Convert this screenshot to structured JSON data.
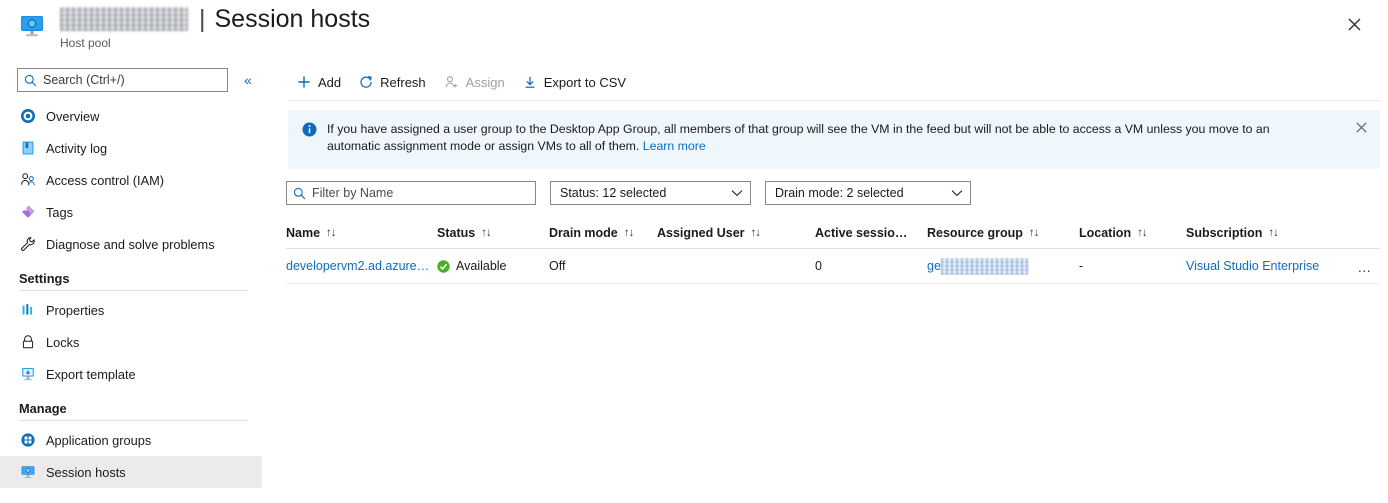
{
  "header": {
    "resource_icon": "virtual-desktop-host-pool-icon",
    "title_redacted": true,
    "separator": "|",
    "title": "Session hosts",
    "subtitle": "Host pool",
    "close_label": "✕"
  },
  "sidebar": {
    "search": {
      "placeholder": "Search (Ctrl+/)",
      "value": "",
      "icon": "search-icon"
    },
    "collapse_icon": "«",
    "items": [
      {
        "label": "Overview",
        "icon": "overview-icon",
        "selected": false
      },
      {
        "label": "Activity log",
        "icon": "activity-log-icon",
        "selected": false
      },
      {
        "label": "Access control (IAM)",
        "icon": "access-control-icon",
        "selected": false
      },
      {
        "label": "Tags",
        "icon": "tags-icon",
        "selected": false
      },
      {
        "label": "Diagnose and solve problems",
        "icon": "diagnose-icon",
        "selected": false
      }
    ],
    "groups": [
      {
        "title": "Settings",
        "items": [
          {
            "label": "Properties",
            "icon": "properties-icon",
            "selected": false
          },
          {
            "label": "Locks",
            "icon": "lock-icon",
            "selected": false
          },
          {
            "label": "Export template",
            "icon": "export-template-icon",
            "selected": false
          }
        ]
      },
      {
        "title": "Manage",
        "items": [
          {
            "label": "Application groups",
            "icon": "application-groups-icon",
            "selected": false
          },
          {
            "label": "Session hosts",
            "icon": "session-hosts-icon",
            "selected": true
          }
        ]
      }
    ]
  },
  "toolbar": {
    "add": {
      "label": "Add",
      "icon": "plus-icon",
      "disabled": false
    },
    "refresh": {
      "label": "Refresh",
      "icon": "refresh-icon",
      "disabled": false
    },
    "assign": {
      "label": "Assign",
      "icon": "assign-user-icon",
      "disabled": true
    },
    "export": {
      "label": "Export to CSV",
      "icon": "download-icon",
      "disabled": false
    }
  },
  "banner": {
    "icon": "info-icon",
    "text": "If you have assigned a user group to the Desktop App Group, all members of that group will see the VM in the feed but will not be able to access a VM unless you move to an automatic assignment mode or assign VMs to all of them.",
    "link_label": "Learn more",
    "close_label": "✕",
    "background": "#eff6fc"
  },
  "filters": {
    "name_filter": {
      "placeholder": "Filter by Name",
      "value": "",
      "icon": "search-icon"
    },
    "status_dropdown": {
      "label": "Status: 12 selected",
      "icon": "chevron-down-icon"
    },
    "drain_dropdown": {
      "label": "Drain mode: 2 selected",
      "icon": "chevron-down-icon"
    }
  },
  "table": {
    "columns": [
      {
        "label": "Name",
        "sortable": true
      },
      {
        "label": "Status",
        "sortable": true
      },
      {
        "label": "Drain mode",
        "sortable": true
      },
      {
        "label": "Assigned User",
        "sortable": true
      },
      {
        "label": "Active sessio…",
        "sortable": false
      },
      {
        "label": "Resource group",
        "sortable": true
      },
      {
        "label": "Location",
        "sortable": true
      },
      {
        "label": "Subscription",
        "sortable": true
      }
    ],
    "sort_icon": "↑↓",
    "rows": [
      {
        "name": "developervm2.ad.azure…",
        "status": "Available",
        "status_icon": "available-check-icon",
        "status_color": "#4caf27",
        "drain_mode": "Off",
        "assigned_user": "",
        "active_sessions": "0",
        "resource_group_prefix": "ge",
        "resource_group_redacted": true,
        "location": "-",
        "subscription": "Visual Studio Enterprise",
        "menu_label": "…"
      }
    ]
  },
  "colors": {
    "accent": "#0f6cbd",
    "banner_bg": "#eff6fc",
    "selected_nav_bg": "#edebe9",
    "success": "#4caf27"
  }
}
